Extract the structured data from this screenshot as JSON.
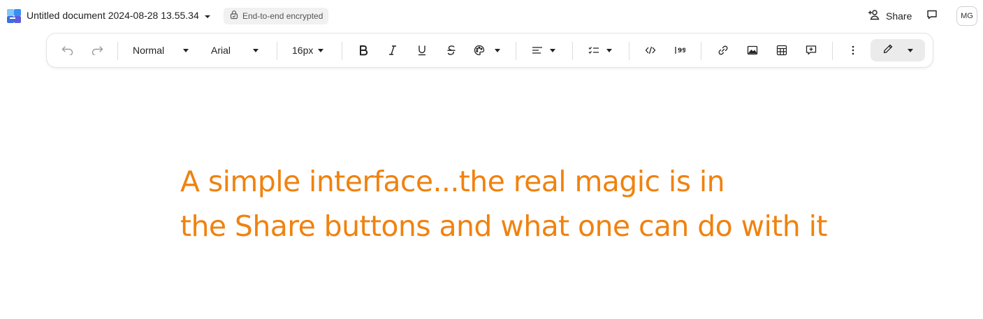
{
  "document": {
    "title": "Untitled document 2024-08-28 13.55.34",
    "encryption_badge": "End-to-end encrypted"
  },
  "header": {
    "share_label": "Share",
    "avatar_initials": "MG"
  },
  "toolbar": {
    "paragraph_style": "Normal",
    "font_family": "Arial",
    "font_size": "16px"
  },
  "content": {
    "line1": "A simple interface...the real magic is in",
    "line2": "the Share buttons and what one can do with it",
    "text_color": "#f0820f"
  },
  "icons": [
    "doc-app-logo-icon",
    "chevron-down-icon",
    "lock-icon",
    "add-person-icon",
    "comment-icon",
    "undo-icon",
    "redo-icon",
    "bold-icon",
    "italic-icon",
    "underline-icon",
    "strikethrough-icon",
    "palette-icon",
    "align-left-icon",
    "checklist-icon",
    "code-icon",
    "quote-icon",
    "link-icon",
    "image-icon",
    "table-icon",
    "add-comment-icon",
    "more-vertical-icon",
    "pencil-icon"
  ]
}
